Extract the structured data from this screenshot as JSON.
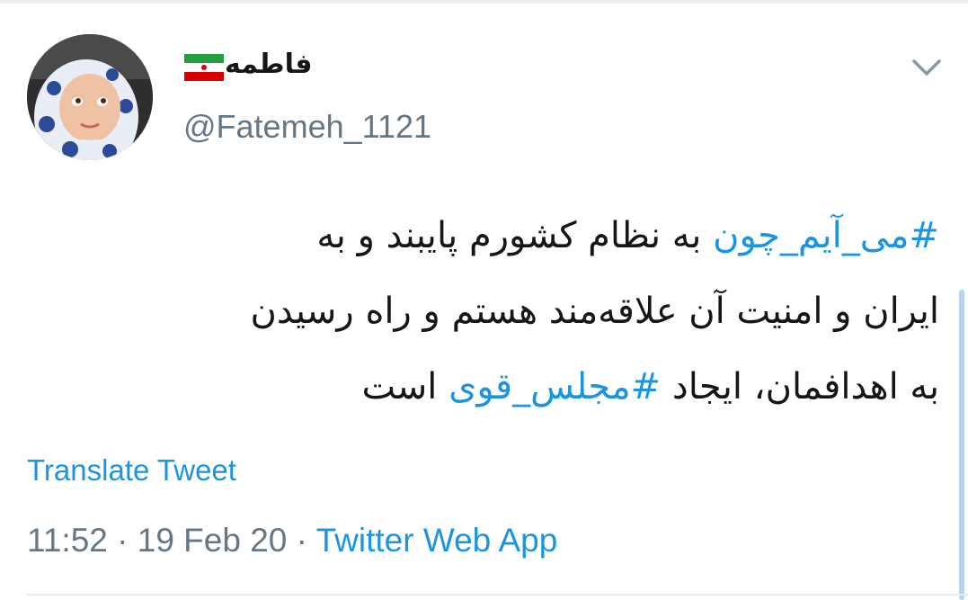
{
  "tweet": {
    "display_name": "فاطمه",
    "handle": "@Fatemeh_1121",
    "line1_hashtag": "#می_آیم_چون",
    "line1_text": " به نظام کشورم پایبند و به",
    "line2_text": "ایران و امنیت آن علاقه‌مند هستم  و راه رسیدن",
    "line3_text_a": "به اهدافمان، ایجاد ",
    "line3_hashtag": "#مجلس_قوی",
    "line3_text_b": " است",
    "translate_label": "Translate Tweet",
    "time": "11:52",
    "separator": " · ",
    "date": "19 Feb 20",
    "source": "Twitter Web App"
  },
  "colors": {
    "link": "#1b95e0",
    "text": "#14171a",
    "muted": "#657786",
    "flag_green": "#239f40",
    "flag_white": "#ffffff",
    "flag_red": "#da0000"
  },
  "icons": {
    "flag": "iran-flag-icon",
    "menu": "chevron-down-icon"
  }
}
